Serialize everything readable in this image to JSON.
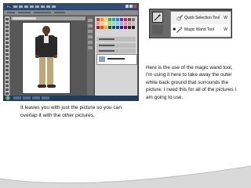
{
  "screenshot": {
    "app_logo": "Ps",
    "canvas_subject": "person photo"
  },
  "tool_menu": {
    "items": [
      {
        "label": "Quick Selection Tool",
        "shortcut": "W",
        "icon": "quick-selection-brush-icon",
        "selected": false
      },
      {
        "label": "Magic Wand Tool",
        "shortcut": "W",
        "icon": "magic-wand-icon",
        "selected": true
      }
    ]
  },
  "text": {
    "right": "Here is the use of the magic wand tool, I'm using it here to take away the outer white back ground that surrounds the picture. I need this for all of the pictures I am going to use.",
    "left": "It leaves you with just the picture so you can overlap it with the other pictures."
  },
  "colors": {
    "accent": "#2f4f74",
    "swoosh": "#d9d9d9",
    "text": "#111111"
  }
}
